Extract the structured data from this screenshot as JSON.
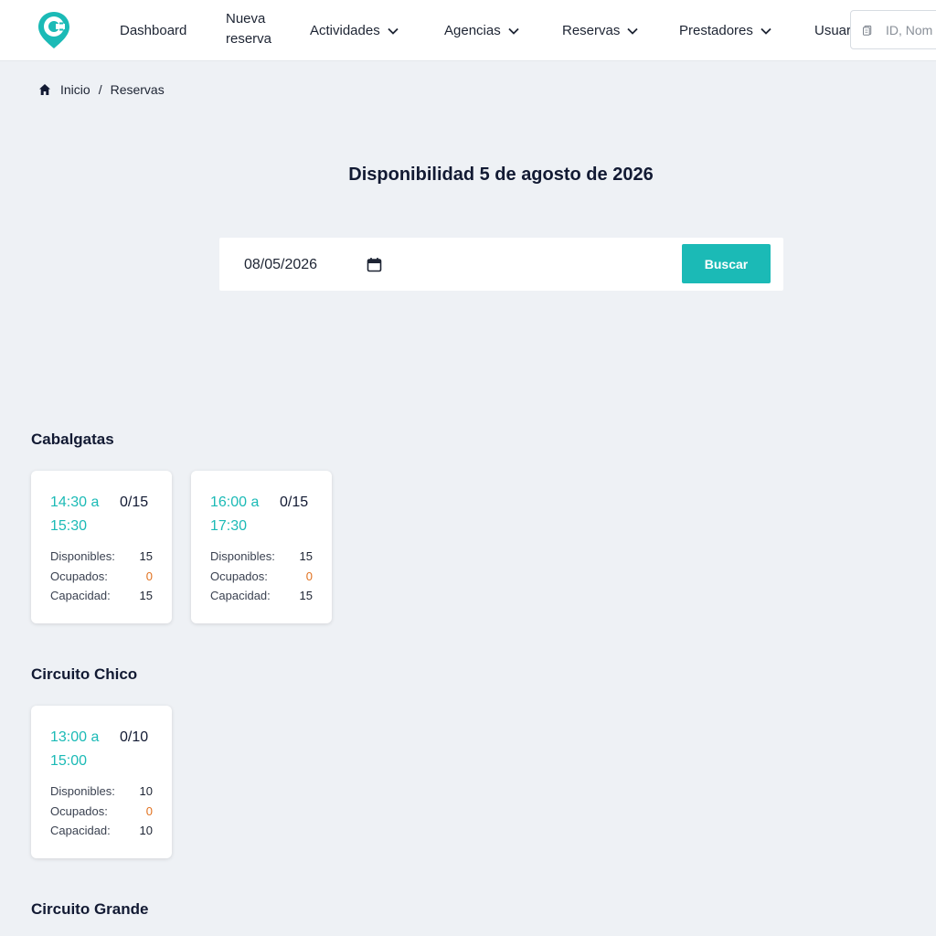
{
  "nav": {
    "items": [
      {
        "label": "Dashboard"
      },
      {
        "label_line1": "Nueva",
        "label_line2": "reserva"
      },
      {
        "label": "Actividades"
      },
      {
        "label": "Agencias"
      },
      {
        "label": "Reservas"
      },
      {
        "label": "Prestadores"
      },
      {
        "label": "Usuar"
      }
    ],
    "search_placeholder": "ID, Nom"
  },
  "breadcrumb": {
    "home": "Inicio",
    "separator": "/",
    "current": "Reservas"
  },
  "page": {
    "title": "Disponibilidad 5 de agosto de 2026",
    "date_value": "08/05/2026",
    "search_button": "Buscar"
  },
  "stat_labels": {
    "available": "Disponibles:",
    "occupied": "Ocupados:",
    "capacity": "Capacidad:"
  },
  "sections": [
    {
      "title": "Cabalgatas",
      "slots": [
        {
          "time_start": "14:30 a",
          "time_end": "15:30",
          "ratio": "0/15",
          "available": "15",
          "occupied": "0",
          "capacity": "15"
        },
        {
          "time_start": "16:00 a",
          "time_end": "17:30",
          "ratio": "0/15",
          "available": "15",
          "occupied": "0",
          "capacity": "15"
        }
      ]
    },
    {
      "title": "Circuito Chico",
      "slots": [
        {
          "time_start": "13:00 a",
          "time_end": "15:00",
          "ratio": "0/10",
          "available": "10",
          "occupied": "0",
          "capacity": "10"
        }
      ]
    },
    {
      "title": "Circuito Grande",
      "slots": []
    }
  ],
  "colors": {
    "accent": "#1bbab6",
    "occupied": "#e1711f",
    "background": "#eef1f5"
  }
}
